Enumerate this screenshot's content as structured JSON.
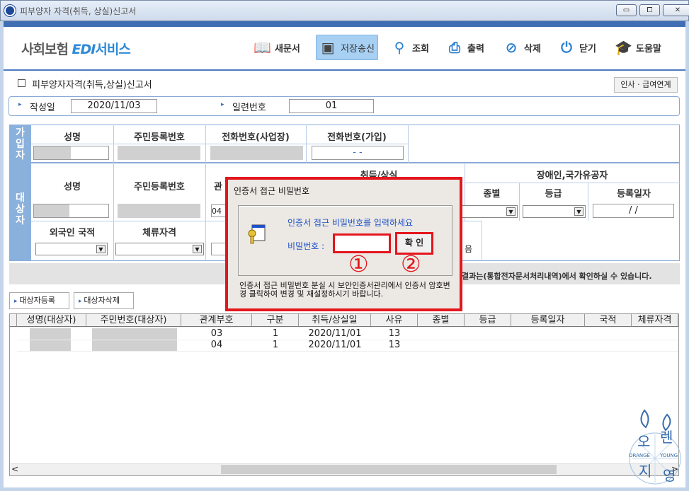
{
  "window": {
    "title": "피부양자 자격(취득, 상실)신고서",
    "btn_min": "▭",
    "btn_max": "⧠",
    "btn_close": "✕"
  },
  "logo": {
    "part1": "사회보험 ",
    "part2": "EDI",
    "part3": "서비스"
  },
  "toolbar": [
    {
      "label": "새문서",
      "icon": "book-icon",
      "glyph": "📖"
    },
    {
      "label": "저장송신",
      "icon": "save-icon",
      "glyph": "▣"
    },
    {
      "label": "조회",
      "icon": "search-pin-icon",
      "glyph": "⚲"
    },
    {
      "label": "출력",
      "icon": "printer-icon",
      "glyph": "⎙"
    },
    {
      "label": "삭제",
      "icon": "delete-icon",
      "glyph": "⊘"
    },
    {
      "label": "닫기",
      "icon": "power-icon",
      "glyph": "⏻"
    },
    {
      "label": "도움말",
      "icon": "graduation-cap-icon",
      "glyph": "🎓"
    }
  ],
  "form": {
    "title": "피부양자자격(취득,상실)신고서",
    "link_button": "인사 · 급여연계"
  },
  "header": {
    "date_label": "작성일",
    "date_value": "2020/11/03",
    "serial_label": "일련번호",
    "serial_value": "01"
  },
  "section1": {
    "side_label": "가입자",
    "cols": [
      "성명",
      "주민등록번호",
      "전화번호(사업장)",
      "전화번호(가입)"
    ],
    "phone_join_value": "-       -"
  },
  "section2": {
    "side_label": "대상자",
    "cols": [
      "성명",
      "주민등록번호",
      "관",
      "취득/상실",
      "장애인,국가유공자"
    ],
    "sub_cols": [
      "종별",
      "등급",
      "등록일자"
    ],
    "rel_value": "04",
    "date_value": " /  /",
    "row2_cols": [
      "외국인 국적",
      "체류자격"
    ],
    "partial_text": "음"
  },
  "notice_text": "결과는(통합전자문서처리내역)에서 확인하실 수 있습니다.",
  "buttons": {
    "register": "대상자등록",
    "delete": "대상자삭제"
  },
  "grid": {
    "headers": [
      "성명(대상자)",
      "주민번호(대상자)",
      "관계부호",
      "구분",
      "취득/상실일",
      "사유",
      "종별",
      "등급",
      "등록일자",
      "국적",
      "체류자격"
    ],
    "rows": [
      {
        "rel": "03",
        "kind": "1",
        "date": "2020/11/01",
        "reason": "13"
      },
      {
        "rel": "04",
        "kind": "1",
        "date": "2020/11/01",
        "reason": "13"
      }
    ],
    "scroll_left": "<",
    "scroll_right": ">"
  },
  "dialog": {
    "title": "인증서 접근 비밀번호",
    "message": "인증서 접근 비밀번호를 입력하세요",
    "pw_label": "비밀번호 :",
    "ok": "확  인",
    "marker1": "①",
    "marker2": "②",
    "note": "인증서 접근 비밀번호 분실 시 보안인증서관리에서 인증서 암호변경 클릭하여 변경 및 재설정하시기 바랍니다."
  },
  "watermark": {
    "k1": "오",
    "k2": "렌",
    "k3": "지",
    "k4": "영",
    "en1": "ORANGE",
    "en2": "YOUNG"
  },
  "colors": {
    "accent": "#e4161d",
    "header_blue": "#3f6eb3",
    "section_blue": "#8ab0dc"
  }
}
